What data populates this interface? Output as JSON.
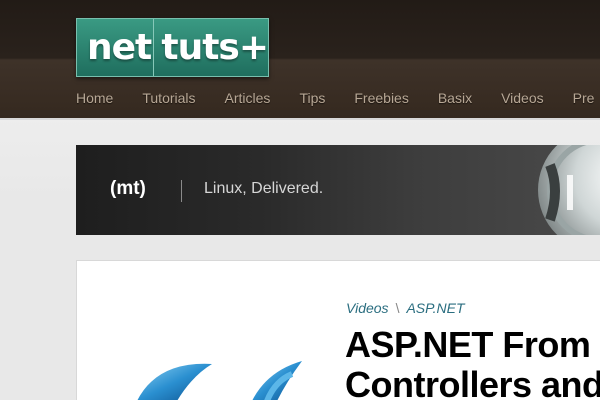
{
  "logo": {
    "part1": "net",
    "part2": "tuts+"
  },
  "nav": {
    "items": [
      {
        "label": "Home"
      },
      {
        "label": "Tutorials"
      },
      {
        "label": "Articles"
      },
      {
        "label": "Tips"
      },
      {
        "label": "Freebies"
      },
      {
        "label": "Basix"
      },
      {
        "label": "Videos"
      },
      {
        "label": "Pre"
      }
    ]
  },
  "banner": {
    "brand": "(mt)",
    "tagline": "Linux, Delivered."
  },
  "article": {
    "breadcrumb": [
      "Videos",
      "ASP.NET"
    ],
    "breadcrumb_separator": "\\",
    "title_line1": "ASP.NET From",
    "title_line2": "Controllers and"
  },
  "colors": {
    "header_bg": "#2a221c",
    "logo_teal": "#2e8a75",
    "nav_text": "#b7a795",
    "link_teal": "#2b6e80",
    "asp_blue": "#2a8fd0"
  },
  "icons": {
    "article": "aspnet-logo-icon",
    "banner": "mediatemple-art-icon"
  }
}
